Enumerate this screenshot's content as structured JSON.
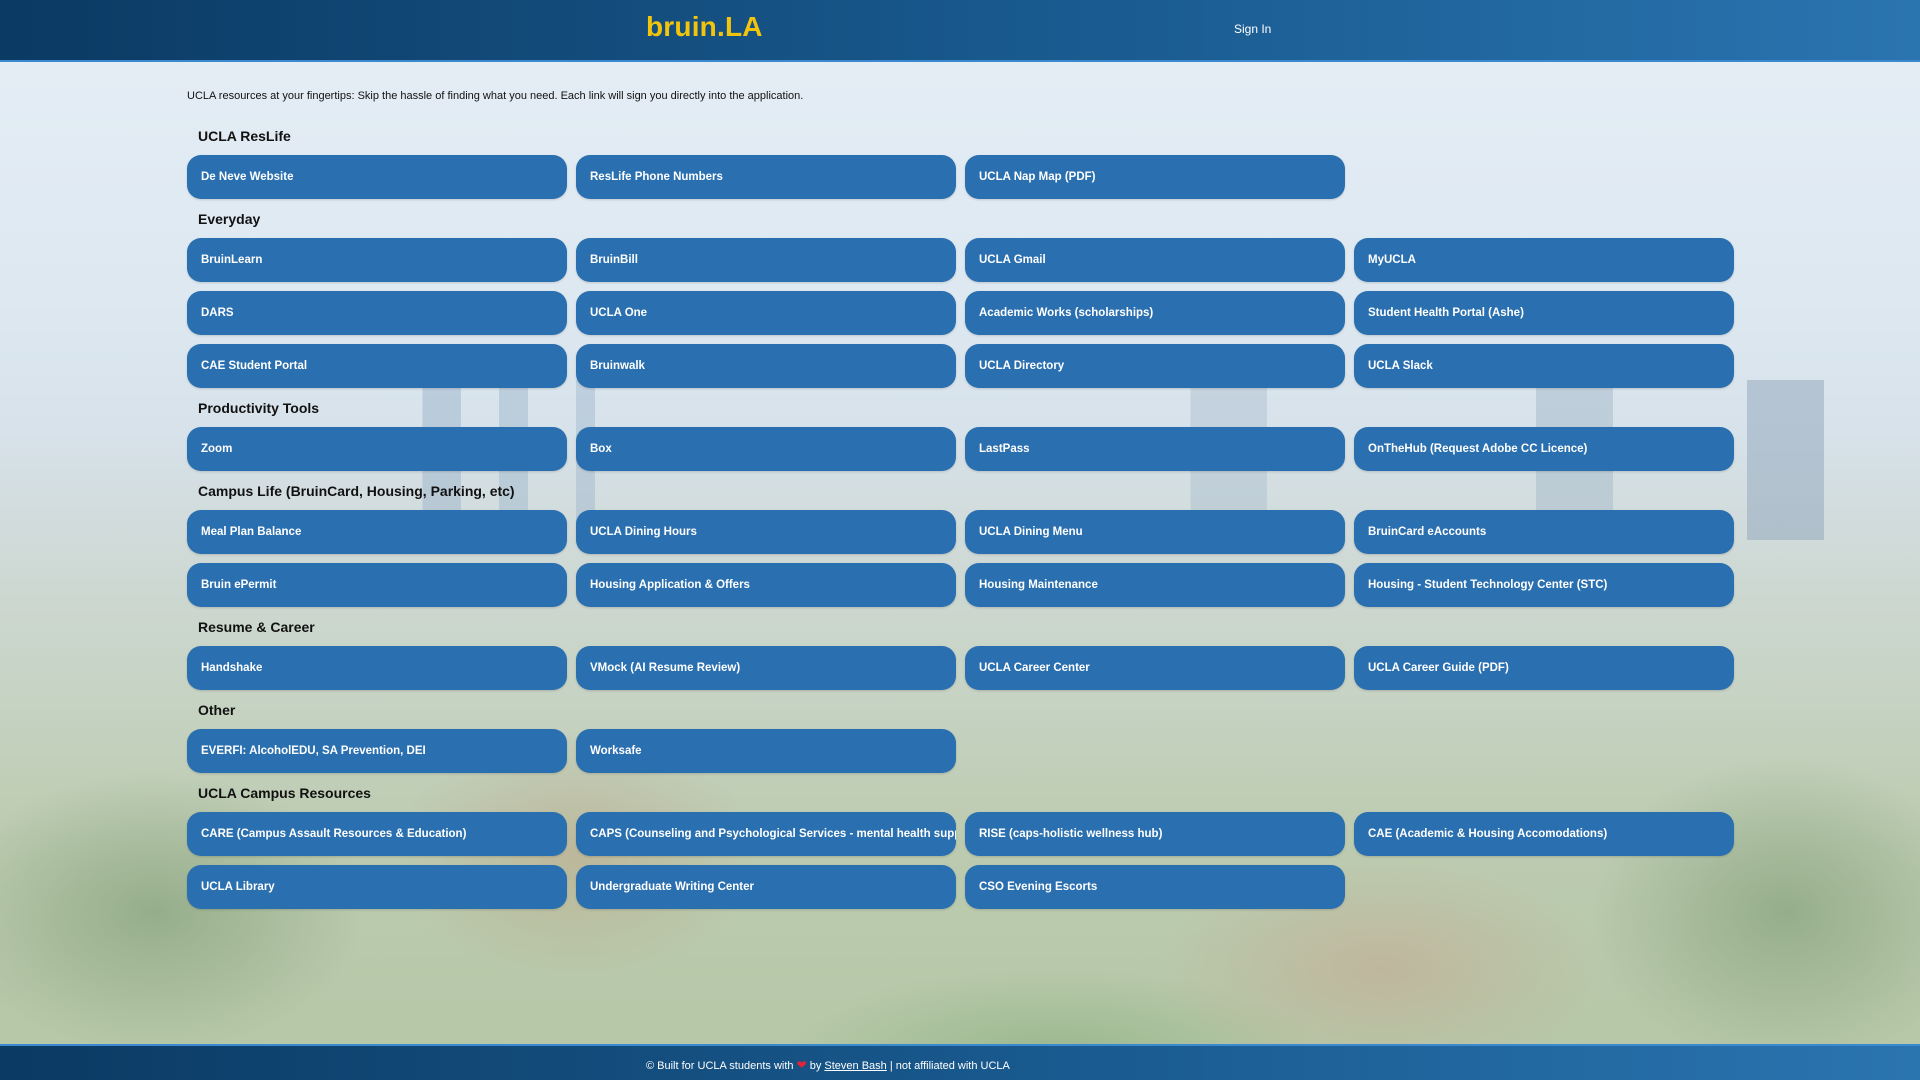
{
  "header": {
    "logo": "bruin.LA",
    "sign_in": "Sign In"
  },
  "intro": "UCLA resources at your fingertips: Skip the hassle of finding what you need. Each link will sign you directly into the application.",
  "sections": [
    {
      "title": "UCLA ResLife",
      "links": [
        "De Neve Website",
        "ResLife Phone Numbers",
        "UCLA Nap Map (PDF)"
      ]
    },
    {
      "title": "Everyday",
      "links": [
        "BruinLearn",
        "BruinBill",
        "UCLA Gmail",
        "MyUCLA",
        "DARS",
        "UCLA One",
        "Academic Works (scholarships)",
        "Student Health Portal (Ashe)",
        "CAE Student Portal",
        "Bruinwalk",
        "UCLA Directory",
        "UCLA Slack"
      ]
    },
    {
      "title": "Productivity Tools",
      "links": [
        "Zoom",
        "Box",
        "LastPass",
        "OnTheHub (Request Adobe CC Licence)"
      ]
    },
    {
      "title": "Campus Life (BruinCard, Housing, Parking, etc)",
      "links": [
        "Meal Plan Balance",
        "UCLA Dining Hours",
        "UCLA Dining Menu",
        "BruinCard eAccounts",
        "Bruin ePermit",
        "Housing Application & Offers",
        "Housing Maintenance",
        "Housing - Student Technology Center (STC)"
      ]
    },
    {
      "title": "Resume & Career",
      "links": [
        "Handshake",
        "VMock (AI Resume Review)",
        "UCLA Career Center",
        "UCLA Career Guide (PDF)"
      ]
    },
    {
      "title": "Other",
      "links": [
        "EVERFI: AlcoholEDU, SA Prevention, DEI",
        "Worksafe"
      ]
    },
    {
      "title": "UCLA Campus Resources",
      "links": [
        "CARE (Campus Assault Resources & Education)",
        "CAPS (Counseling and Psychological Services - mental health support)",
        "RISE (caps-holistic wellness hub)",
        "CAE (Academic & Housing Accomodations)",
        "UCLA Library",
        "Undergraduate Writing Center",
        "CSO Evening Escorts"
      ]
    }
  ],
  "footer": {
    "prefix": "© Built for UCLA students with",
    "heart_icon": "heart-icon",
    "by": "by",
    "author": "Steven Bash",
    "suffix": "| not affiliated with UCLA"
  },
  "colors": {
    "header": "#195a8f",
    "button": "#2a6faf",
    "logo": "#f2c40c",
    "heart": "#e0243a"
  }
}
